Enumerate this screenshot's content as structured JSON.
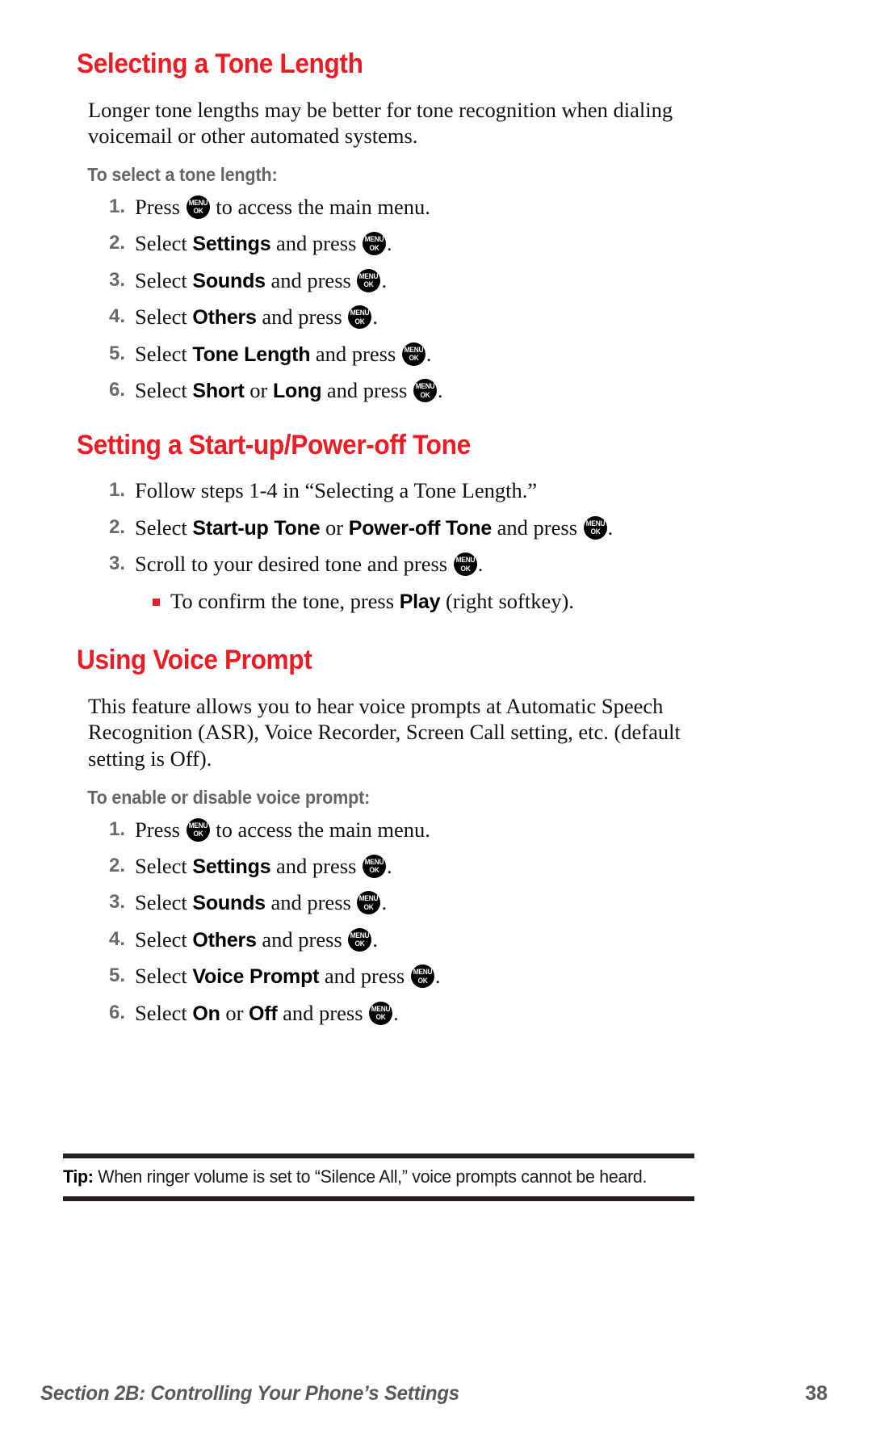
{
  "colors": {
    "heading_red": "#ED1C24",
    "subheading_gray": "#656565",
    "step_number_gray": "#6a6a6a",
    "footer_gray": "#595959",
    "rule_black": "#231f20",
    "body_text": "#111111"
  },
  "icons": {
    "menu_key_line1": "MENU",
    "menu_key_line2": "OK",
    "bullet": "red-square-bullet"
  },
  "sections": [
    {
      "id": "selecting-a-tone-length",
      "heading": "Selecting a Tone Length",
      "paragraph": "Longer tone lengths may be better for tone recognition when dialing voicemail or other automated systems.",
      "subheading": "To select a tone length:",
      "steps": [
        {
          "num": "1",
          "pre": "Press ",
          "bold": "",
          "mid": "",
          "bold2": "",
          "post": " to access the main menu.",
          "icon_after_pre": true,
          "icon_at_end": false
        },
        {
          "num": "2",
          "pre": "Select ",
          "bold": "Settings",
          "mid": " and press ",
          "bold2": "",
          "post": ".",
          "icon_after_pre": false,
          "icon_at_end": true
        },
        {
          "num": "3",
          "pre": "Select ",
          "bold": "Sounds",
          "mid": " and press ",
          "bold2": "",
          "post": ".",
          "icon_after_pre": false,
          "icon_at_end": true
        },
        {
          "num": "4",
          "pre": "Select ",
          "bold": "Others",
          "mid": " and press ",
          "bold2": "",
          "post": ".",
          "icon_after_pre": false,
          "icon_at_end": true
        },
        {
          "num": "5",
          "pre": "Select ",
          "bold": "Tone Length",
          "mid": " and press ",
          "bold2": "",
          "post": ".",
          "icon_after_pre": false,
          "icon_at_end": true
        },
        {
          "num": "6",
          "pre": "Select ",
          "bold": "Short",
          "mid": " or ",
          "bold2": "Long",
          "post": " and press ",
          "tail": ".",
          "icon_after_pre": false,
          "icon_at_end": true
        }
      ]
    },
    {
      "id": "setting-a-startup-poweroff-tone",
      "heading": "Setting a Start-up/Power-off Tone",
      "steps": [
        {
          "num": "1",
          "pre": "Follow steps 1-4 in “Selecting a Tone Length.”",
          "bold": "",
          "mid": "",
          "bold2": "",
          "post": "",
          "icon_after_pre": false,
          "icon_at_end": false
        },
        {
          "num": "2",
          "pre": "Select ",
          "bold": "Start-up Tone",
          "mid": " or ",
          "bold2": "Power-off Tone",
          "post": " and press ",
          "tail": ".",
          "icon_after_pre": false,
          "icon_at_end": true
        },
        {
          "num": "3",
          "pre": "Scroll to your desired tone and press ",
          "bold": "",
          "mid": "",
          "bold2": "",
          "post": ".",
          "icon_after_pre": false,
          "icon_at_end": true
        }
      ],
      "sub_bullet": {
        "pre": "To confirm the tone, press ",
        "bold": "Play",
        "post": " (right softkey)."
      }
    },
    {
      "id": "using-voice-prompt",
      "heading": "Using Voice Prompt",
      "paragraph": "This feature allows you to hear voice prompts at Automatic Speech Recognition (ASR), Voice Recorder, Screen Call setting, etc. (default setting is Off).",
      "subheading": "To enable or disable voice prompt:",
      "steps": [
        {
          "num": "1",
          "pre": "Press ",
          "bold": "",
          "mid": "",
          "bold2": "",
          "post": " to access the main menu.",
          "icon_after_pre": true,
          "icon_at_end": false
        },
        {
          "num": "2",
          "pre": "Select ",
          "bold": "Settings",
          "mid": " and press ",
          "bold2": "",
          "post": ".",
          "icon_after_pre": false,
          "icon_at_end": true
        },
        {
          "num": "3",
          "pre": "Select ",
          "bold": "Sounds",
          "mid": " and press ",
          "bold2": "",
          "post": ".",
          "icon_after_pre": false,
          "icon_at_end": true
        },
        {
          "num": "4",
          "pre": "Select ",
          "bold": "Others",
          "mid": " and press ",
          "bold2": "",
          "post": ".",
          "icon_after_pre": false,
          "icon_at_end": true
        },
        {
          "num": "5",
          "pre": "Select ",
          "bold": "Voice Prompt",
          "mid": " and press ",
          "bold2": "",
          "post": ".",
          "icon_after_pre": false,
          "icon_at_end": true
        },
        {
          "num": "6",
          "pre": "Select ",
          "bold": "On",
          "mid": " or ",
          "bold2": "Off",
          "post": " and press ",
          "tail": ".",
          "icon_after_pre": false,
          "icon_at_end": true
        }
      ]
    }
  ],
  "tip": {
    "label": "Tip:",
    "text": " When ringer volume is set to “Silence All,” voice prompts cannot be heard."
  },
  "footer": {
    "title": "Section 2B: Controlling Your Phone’s Settings",
    "page": "38"
  }
}
